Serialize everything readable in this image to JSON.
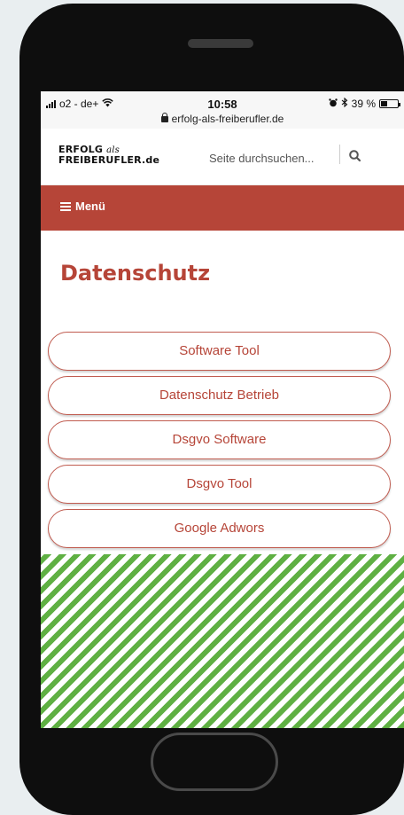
{
  "statusbar": {
    "carrier": "o2 - de+",
    "time": "10:58",
    "battery": "39 %",
    "battery_level": 0.39,
    "url": "erfolg-als-freiberufler.de"
  },
  "header": {
    "logo_line1": "ERFOLG",
    "logo_als": "als",
    "logo_line2": "FREIBERUFLER.de",
    "search_placeholder": "Seite durchsuchen..."
  },
  "menu": {
    "label": "Menü"
  },
  "page": {
    "title": "Datenschutz"
  },
  "links": [
    {
      "label": "Software Tool"
    },
    {
      "label": "Datenschutz Betrieb"
    },
    {
      "label": "Dsgvo Software"
    },
    {
      "label": "Dsgvo Tool"
    },
    {
      "label": "Google Adwors"
    }
  ],
  "colors": {
    "accent": "#b64538",
    "ad_stripe": "#5fb043",
    "phone_body": "#0e0e0e",
    "background": "#e9eef0"
  }
}
